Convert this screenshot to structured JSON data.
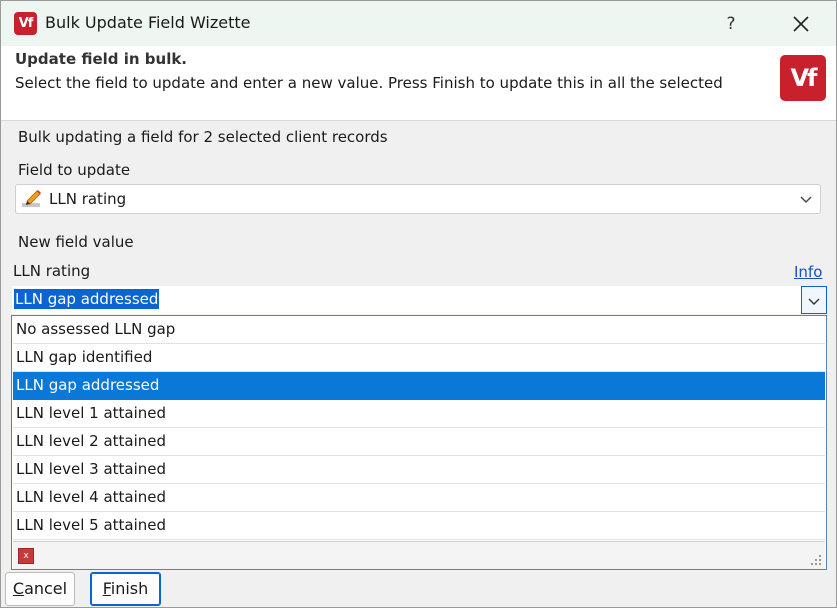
{
  "window": {
    "title": "Bulk Update Field Wizette",
    "help_label": "?",
    "logo_text": "Vf"
  },
  "header": {
    "title": "Update field in bulk.",
    "description": "Select the field to update and enter a new value. Press Finish to update this in all the selected",
    "logo_text": "Vf"
  },
  "body": {
    "info_line": "Bulk updating a field for 2 selected client records",
    "field_to_update_label": "Field to update",
    "field_to_update_value": "LLN rating",
    "field_icon": "pencil-edit-icon",
    "new_value_label": "New field value",
    "value_field_label": "LLN rating",
    "info_link": "Info",
    "current_value": "LLN gap addressed"
  },
  "dropdown": {
    "options": [
      "No assessed LLN gap",
      "LLN gap identified",
      "LLN gap addressed",
      "LLN level 1 attained",
      "LLN level 2 attained",
      "LLN level 3 attained",
      "LLN level 4 attained",
      "LLN level 5 attained"
    ],
    "selected_index": 2,
    "clear_label": "x"
  },
  "buttons": {
    "cancel_first": "C",
    "cancel_rest": "ancel",
    "finish_first": "F",
    "finish_rest": "inish"
  },
  "colors": {
    "accent": "#0a78d7",
    "brand": "#c8202c"
  }
}
